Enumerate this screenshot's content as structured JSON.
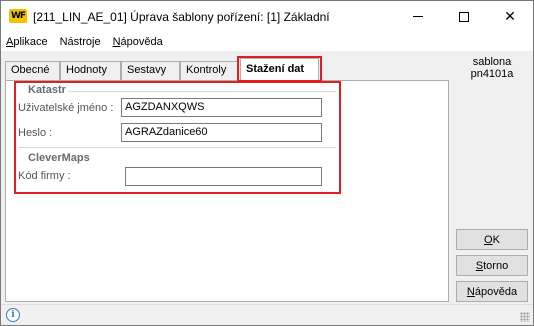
{
  "window": {
    "icon_text": "WF",
    "title": "[211_LIN_AE_01] Úprava šablony pořízení: [1] Základní"
  },
  "menu": [
    {
      "label": "Aplikace",
      "underline": "A",
      "rest": "plikace"
    },
    {
      "label": "Nástroje",
      "pre": "Nástro",
      "underline": "j",
      "post": "e"
    },
    {
      "label": "Nápověda",
      "underline": "N",
      "rest": "ápověda"
    }
  ],
  "tabs": [
    {
      "label": "Obecné",
      "active": false
    },
    {
      "label": "Hodnoty",
      "active": false
    },
    {
      "label": "Sestavy",
      "active": false
    },
    {
      "label": "Kontroly",
      "active": false
    },
    {
      "label": "Stažení dat",
      "active": true
    }
  ],
  "katastr": {
    "title": "Katastr",
    "username_label": "Uživatelské jméno :",
    "username_value": "AGZDANXQWS",
    "password_label": "Heslo :",
    "password_value": "AGRAZdanice60"
  },
  "clevermaps": {
    "title": "CleverMaps",
    "company_code_label": "Kód firmy :",
    "company_code_value": ""
  },
  "sidebar": {
    "line1": "sablona",
    "line2": "pn4101a"
  },
  "buttons": {
    "ok": {
      "label": "OK",
      "underline": "O",
      "rest": "K"
    },
    "storno": {
      "label": "Storno",
      "underline": "S",
      "rest": "torno"
    },
    "napoveda": {
      "label": "Nápověda",
      "underline": "N",
      "rest": "ápověda"
    }
  },
  "colors": {
    "highlight": "#e02020",
    "icon_yellow": "#f2c200",
    "info_blue": "#3a78c9"
  },
  "icons": {
    "app": "wf-app-icon",
    "status": "info-icon",
    "resize": "resize-grip-icon"
  }
}
